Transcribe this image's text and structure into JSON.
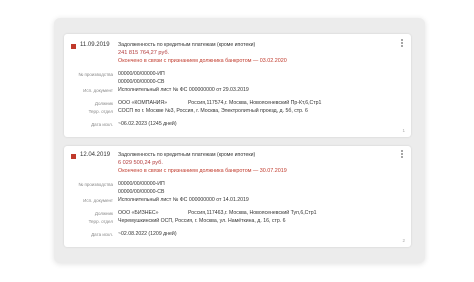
{
  "labels": {
    "proceeding_no": "№ производства",
    "exec_doc": "Исп. документ",
    "debtor": "Должник",
    "territorial_dept": "Терр. отдел",
    "expiry_date": "Дата искл."
  },
  "cards": [
    {
      "date": "11.09.2019",
      "title": "Задолженность по кредитным платежам (кроме ипотеки)",
      "amount": "241 815 764,27 руб.",
      "closed_text": "Окончено в связи с признанием должника банкротом — 03.02.2020",
      "proceeding_1": "00000/00/00000-ИП",
      "proceeding_2": "00000/00/00000-СВ",
      "exec_doc": "Исполнительный лист № ФС 000000000 от 29.03.2019",
      "debtor_name": "ООО «КОМПАНИЯ»",
      "debtor_address": "Россия,117574,г. Москва, Новоясеневский Пр-Кт,6,Стр1",
      "territorial_dept": "СОСП по г. Москве №3, Россия, г. Москва, Электролитный проезд, д. 5б, стр. 6",
      "expiry": "~06.02.2023 (1245 дней)",
      "page": "1"
    },
    {
      "date": "12.04.2019",
      "title": "Задолженность по кредитным платежам (кроме ипотеки)",
      "amount": "6 029 500,24 руб.",
      "closed_text": "Окончено в связи с признанием должника банкротом — 30.07.2019",
      "proceeding_1": "00000/00/00000-ИП",
      "proceeding_2": "00000/00/00000-СВ",
      "exec_doc": "Исполнительный лист № ФС 000000000 от 14.01.2019",
      "debtor_name": "ООО «БИЗНЕС»",
      "debtor_address": "Россия,117463,г. Москва, Новоясеневский Туп,6,Стр1",
      "territorial_dept": "Черемушкинский ОСП, Россия, г. Москва, ул. Намёткина, д. 16, стр. 6",
      "expiry": "~02.08.2022 (1209 дней)",
      "page": "2"
    }
  ]
}
